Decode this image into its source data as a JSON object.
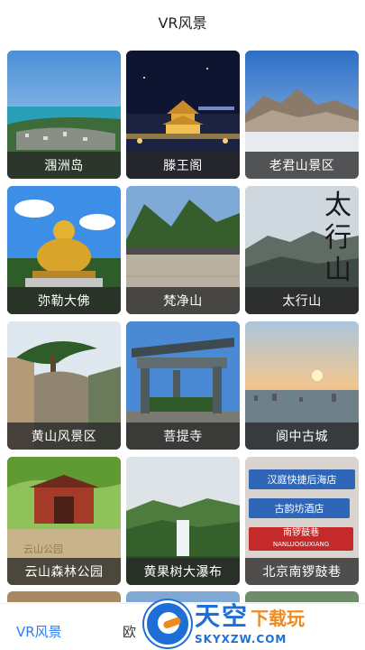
{
  "header": {
    "title": "VR风景"
  },
  "tiles": [
    {
      "name": "tile-weizhou-island",
      "label": "涠洲岛",
      "icon": "island-aerial-scene"
    },
    {
      "name": "tile-tengwang-pavilion",
      "label": "滕王阁",
      "icon": "night-pavilion-scene"
    },
    {
      "name": "tile-laojun-mountain",
      "label": "老君山景区",
      "icon": "mountain-cloud-scene"
    },
    {
      "name": "tile-maitreya-buddha",
      "label": "弥勒大佛",
      "icon": "golden-buddha-scene"
    },
    {
      "name": "tile-fanjing-mountain",
      "label": "梵净山",
      "icon": "mountain-trail-scene"
    },
    {
      "name": "tile-taihang-mountain",
      "label": "太行山",
      "icon": "taihang-calligraphy-scene"
    },
    {
      "name": "tile-huangshan",
      "label": "黄山风景区",
      "icon": "pine-cliff-scene"
    },
    {
      "name": "tile-bodhi-temple",
      "label": "菩提寺",
      "icon": "temple-gate-scene"
    },
    {
      "name": "tile-langzhong-ancient-city",
      "label": "阆中古城",
      "icon": "sunset-city-scene"
    },
    {
      "name": "tile-yunshan-forest-park",
      "label": "云山森林公园",
      "icon": "park-pavilion-scene"
    },
    {
      "name": "tile-huangguoshu-waterfall",
      "label": "黄果树大瀑布",
      "icon": "waterfall-valley-scene"
    },
    {
      "name": "tile-nanluoguxiang",
      "label": "北京南锣鼓巷",
      "icon": "street-signs-scene"
    }
  ],
  "tile_images": {
    "taihang_calligraphy": "太行山",
    "yunshan_sign": "云山公园",
    "sign_1": "汉庭快捷后海店",
    "sign_2": "古韵坊酒店",
    "sign_3": "南锣鼓巷",
    "sign_3_pinyin": "NANLUOGUXIANG"
  },
  "bottom_nav": {
    "tab_active": "VR风景",
    "tab_2_partial": "欧"
  },
  "watermark": {
    "title_main": "天空",
    "title_accent": "下载玩",
    "url": "SKYXZW.COM"
  },
  "colors": {
    "accent_blue": "#2a7ff0",
    "label_overlay": "#282828",
    "watermark_blue": "#1d6fd6",
    "watermark_orange": "#f08a1c"
  }
}
